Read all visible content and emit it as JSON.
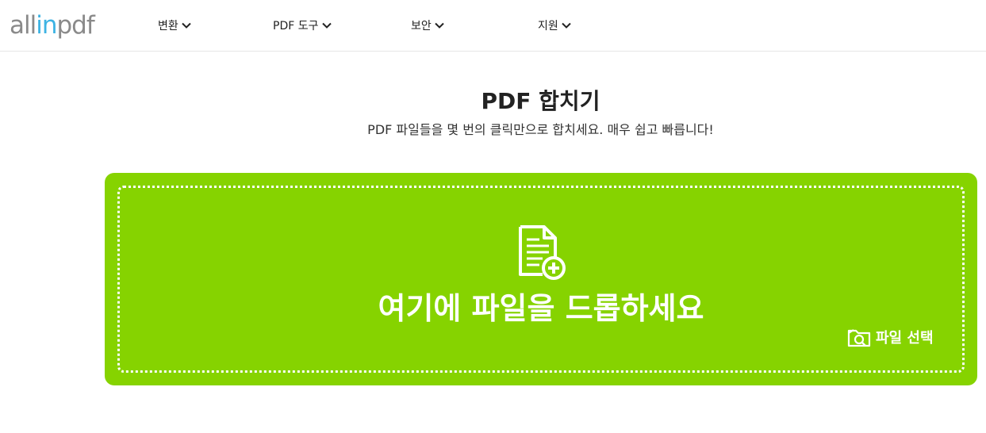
{
  "logo": {
    "part1": "all",
    "part2": "in",
    "part3": "pdf"
  },
  "nav": {
    "convert": "변환",
    "pdf_tools": "PDF 도구",
    "security": "보안",
    "support": "지원"
  },
  "main": {
    "title": "PDF 합치기",
    "subtitle": "PDF 파일들을 몇 번의 클릭만으로 합치세요. 매우 쉽고 빠릅니다!"
  },
  "dropzone": {
    "drop_text": "여기에 파일을 드롭하세요",
    "select_label": "파일 선택",
    "background_color": "#86d300"
  }
}
